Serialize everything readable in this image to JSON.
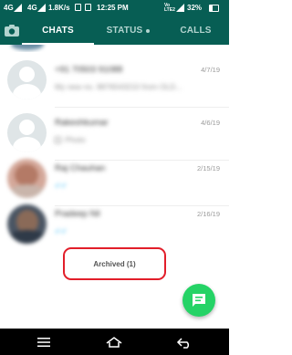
{
  "status_bar": {
    "network1": "4G",
    "network2": "4G",
    "speed": "1.8K/s",
    "time": "12:25 PM",
    "volte": "Vo\nLTE2",
    "battery": "32%"
  },
  "tabs": [
    {
      "label": "CHATS",
      "active": true
    },
    {
      "label": "STATUS",
      "active": false,
      "dot": true
    },
    {
      "label": "CALLS",
      "active": false
    }
  ],
  "chats": [
    {
      "name": "+91 70503 91088",
      "preview": "My new no. 9876543210 from OLD...",
      "time": "4/7/19",
      "avatar": "default"
    },
    {
      "name": "Rakeshkumar",
      "preview": "Photo",
      "time": "4/6/19",
      "avatar": "default"
    },
    {
      "name": "Raj Chauhan",
      "preview": "",
      "time": "2/15/19",
      "avatar": "photo"
    },
    {
      "name": "Pradeep Nil",
      "preview": "",
      "time": "2/16/19",
      "avatar": "photo"
    }
  ],
  "archived_label": "Archived (1)",
  "icons": {
    "camera": "camera-icon",
    "fab": "new-chat-icon",
    "nav_menu": "menu-icon",
    "nav_home": "home-icon",
    "nav_back": "back-icon"
  },
  "colors": {
    "header": "#075e54",
    "fab": "#25d366",
    "highlight": "#e21e2a"
  }
}
